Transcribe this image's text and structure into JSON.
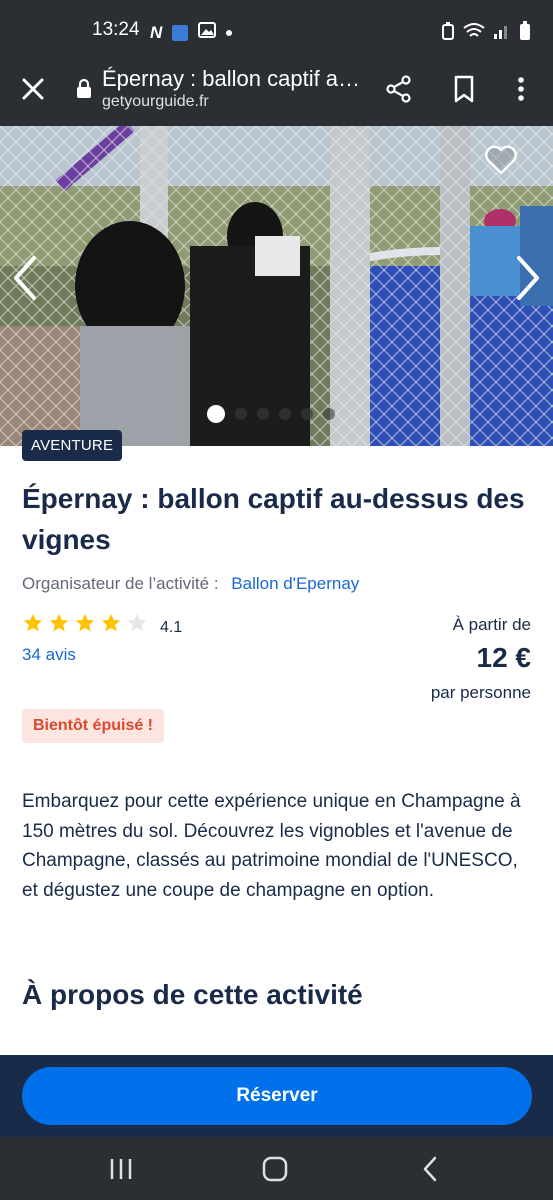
{
  "status_bar": {
    "time": "13:24",
    "left_icons": [
      "netflix-icon",
      "folder-icon",
      "image-icon",
      "dot-icon"
    ],
    "right_icons": [
      "battery-saver-icon",
      "wifi-icon",
      "signal-icon",
      "battery-icon"
    ]
  },
  "browser": {
    "title": "Épernay : ballon captif au-dessus des vignes",
    "url": "getyourguide.fr",
    "icons": [
      "close-icon",
      "lock-icon",
      "share-icon",
      "bookmark-icon",
      "more-icon"
    ]
  },
  "gallery": {
    "image_count": 6,
    "active_index": 0
  },
  "activity": {
    "category_badge": "AVENTURE",
    "title": "Épernay : ballon captif au-dessus des vignes",
    "organizer_label": "Organisateur de l’activité :",
    "organizer_name": "Ballon d'Epernay",
    "rating": "4.1",
    "rating_stars": 4.1,
    "reviews_label": "34 avis",
    "price_from_label": "À partir de",
    "price": "12 €",
    "price_unit": "par personne",
    "availability_badge": "Bientôt épuisé !",
    "description": "Embarquez pour cette expérience unique en Champagne à 150 mètres du sol. Découvrez les vignobles et l'avenue de Champagne, classés au patrimoine mondial de l'UNESCO, et dégustez une coupe de champagne en option."
  },
  "about_section": {
    "title": "À propos de cette activité"
  },
  "cta": {
    "reserve_label": "Réserver"
  },
  "colors": {
    "navy": "#1a2b49",
    "primary_blue": "#0071eb",
    "link_blue": "#1a68d4",
    "star_yellow": "#ffc300",
    "alert_red": "#dc4a2b",
    "alert_bg": "#fde5e1",
    "system_bar": "#2b2e33"
  },
  "system_nav": {
    "icons": [
      "recents-icon",
      "home-icon",
      "back-icon"
    ]
  }
}
